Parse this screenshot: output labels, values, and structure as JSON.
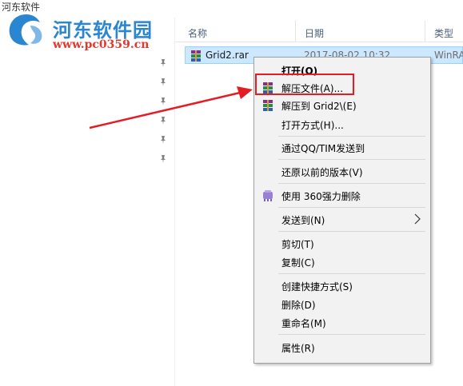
{
  "window": {
    "title": "河东软件"
  },
  "watermark": {
    "name": "河东软件园",
    "url": "www.pc0359.cn"
  },
  "columns": {
    "name": "名称",
    "date": "日期",
    "type": "类型"
  },
  "file": {
    "name": "Grid2.rar",
    "date": "2017-08-02 10:32",
    "type": "WinRA",
    "icon": "winrar-archive-icon"
  },
  "menu": {
    "items": [
      {
        "label": "打开(O)",
        "bold": true
      },
      {
        "label": "解压文件(A)...",
        "icon": "winrar-icon"
      },
      {
        "label": "解压到 Grid2\\(E)",
        "icon": "winrar-icon"
      },
      {
        "label": "打开方式(H)..."
      },
      {
        "label": "通过QQ/TIM发送到"
      },
      {
        "label": "还原以前的版本(V)"
      },
      {
        "label": "使用 360强力删除",
        "icon": "360-shredder-icon"
      },
      {
        "label": "发送到(N)",
        "submenu": true
      },
      {
        "label": "剪切(T)"
      },
      {
        "label": "复制(C)"
      },
      {
        "label": "创建快捷方式(S)"
      },
      {
        "label": "删除(D)"
      },
      {
        "label": "重命名(M)"
      },
      {
        "label": "属性(R)"
      }
    ]
  },
  "colors": {
    "selection": "#cce8ff",
    "highlight": "#e51c24",
    "menu_bg": "#f2f2f2"
  }
}
